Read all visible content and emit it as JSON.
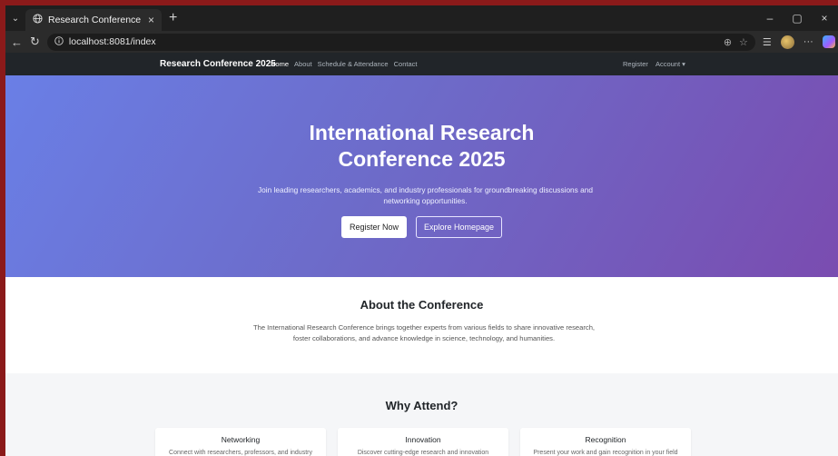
{
  "browser": {
    "tab_title": "Research Conference Registration",
    "tab_close": "×",
    "new_tab": "+",
    "url": "localhost:8081/index",
    "minimize": "–",
    "maximize": "▢",
    "close": "×"
  },
  "site": {
    "brand": "Research Conference 2025",
    "nav": [
      "Home",
      "About",
      "Schedule & Attendance",
      "Contact"
    ],
    "register": "Register",
    "account": "Account ▾"
  },
  "hero": {
    "title_line1": "International Research",
    "title_line2": "Conference 2025",
    "subtitle": "Join leading researchers, academics, and industry professionals for groundbreaking discussions and networking opportunities.",
    "primary_button": "Register Now",
    "secondary_button": "Explore Homepage"
  },
  "about": {
    "heading": "About the Conference",
    "body": "The International Research Conference brings together experts from various fields to share innovative research, foster collaborations, and advance knowledge in science, technology, and humanities."
  },
  "why": {
    "heading": "Why Attend?",
    "cards": [
      {
        "title": "Networking",
        "desc": "Connect with researchers, professors, and industry"
      },
      {
        "title": "Innovation",
        "desc": "Discover cutting-edge research and innovation"
      },
      {
        "title": "Recognition",
        "desc": "Present your work and gain recognition in your field"
      }
    ]
  },
  "colors": {
    "hero_start": "#6a7fe6",
    "hero_end": "#7a4cb0",
    "navbar": "#212529"
  }
}
